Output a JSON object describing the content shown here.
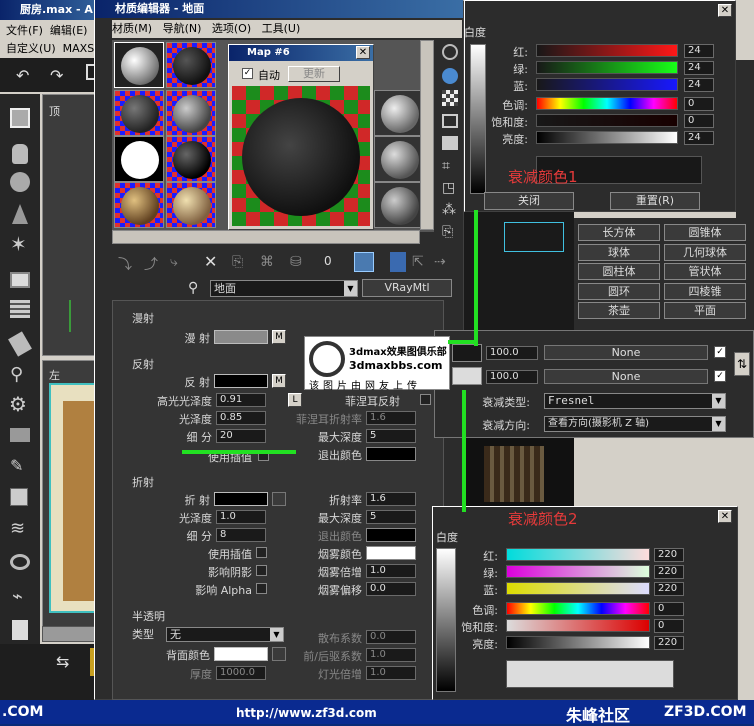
{
  "main_window": {
    "title": "厨房.max - A",
    "menus": [
      "文件(F)",
      "编辑(E)"
    ],
    "menus2": [
      "自定义(U)",
      "MAXSc"
    ],
    "viewport_top": "顶",
    "viewport_left": "左"
  },
  "mat_editor": {
    "title": "材质编辑器 - 地面",
    "menus": [
      "材质(M)",
      "导航(N)",
      "选项(O)",
      "工具(U)"
    ],
    "material_name": "地面",
    "material_type": "VRayMtl"
  },
  "map_window": {
    "title": "Map #6",
    "auto_label": "自动",
    "update_label": "更新"
  },
  "watermark": {
    "site": "3dmax效果图俱乐部",
    "url": "3dmaxbbs.com",
    "note": "该图片由网友上传"
  },
  "diffuse": {
    "section": "漫射",
    "label": "漫 射",
    "m": "M"
  },
  "reflect": {
    "section": "反射",
    "label": "反 射",
    "m": "M",
    "hilight_label": "高光光泽度",
    "hilight": "0.91",
    "l": "L",
    "fresnel_label": "菲涅耳反射",
    "gloss_label": "光泽度",
    "gloss": "0.85",
    "fresnel_ior_label": "菲涅耳折射率",
    "fresnel_ior": "1.6",
    "subdiv_label": "细 分",
    "subdiv": "20",
    "maxdepth_label": "最大深度",
    "maxdepth": "5",
    "interp_label": "使用插值",
    "exit_label": "退出颜色"
  },
  "refract": {
    "section": "折射",
    "label": "折 射",
    "ior_label": "折射率",
    "ior": "1.6",
    "gloss_label": "光泽度",
    "gloss": "1.0",
    "maxdepth_label": "最大深度",
    "maxdepth": "5",
    "subdiv_label": "细 分",
    "subdiv": "8",
    "exit_label": "退出颜色",
    "interp_label": "使用插值",
    "fog_color_label": "烟雾颜色",
    "shadow_label": "影响阴影",
    "fog_mult_label": "烟雾倍增",
    "fog_mult": "1.0",
    "alpha_label": "影响 Alpha",
    "fog_bias_label": "烟雾偏移",
    "fog_bias": "0.0"
  },
  "translucent": {
    "section": "半透明",
    "type_label": "类型",
    "type": "无",
    "back_label": "背面颜色",
    "scatter_label": "散布系数",
    "scatter": "0.0",
    "fb_label": "前/后驱系数",
    "fb": "1.0",
    "thick_label": "厚度",
    "thick": "1000.0",
    "light_label": "灯光倍增",
    "light": "1.0"
  },
  "falloff": {
    "v1": "100.0",
    "none1": "None",
    "v2": "100.0",
    "none2": "None",
    "type_label": "衰减类型:",
    "type": "Fresnel",
    "dir_label": "衰减方向:",
    "dir": "查看方向(摄影机 Z 轴)"
  },
  "color1": {
    "white_label": "白度",
    "red_label": "红:",
    "red": "24",
    "green_label": "绿:",
    "green": "24",
    "blue_label": "蓝:",
    "blue": "24",
    "hue_label": "色调:",
    "hue": "0",
    "sat_label": "饱和度:",
    "sat": "0",
    "val_label": "亮度:",
    "val": "24",
    "caption": "衰减颜色1",
    "close": "关闭",
    "reset": "重置(R)",
    "swatch": "#181818"
  },
  "color2": {
    "white_label": "白度",
    "red_label": "红:",
    "red": "220",
    "green_label": "绿:",
    "green": "220",
    "blue_label": "蓝:",
    "blue": "220",
    "hue_label": "色调:",
    "hue": "0",
    "sat_label": "饱和度:",
    "sat": "0",
    "val_label": "亮度:",
    "val": "220",
    "caption": "衰减颜色2",
    "swatch": "#dcdcdc"
  },
  "primitives": [
    "长方体",
    "圆锥体",
    "球体",
    "几何球体",
    "圆柱体",
    "管状体",
    "圆环",
    "四棱锥",
    "茶壶",
    "平面"
  ],
  "footer": {
    "left": ".COM",
    "url": "http://www.zf3d.com",
    "brand": "朱峰社区",
    "domain": "ZF3D.COM"
  },
  "colors": {
    "accent_green": "#22e022",
    "caption_red": "#e53a3a"
  }
}
